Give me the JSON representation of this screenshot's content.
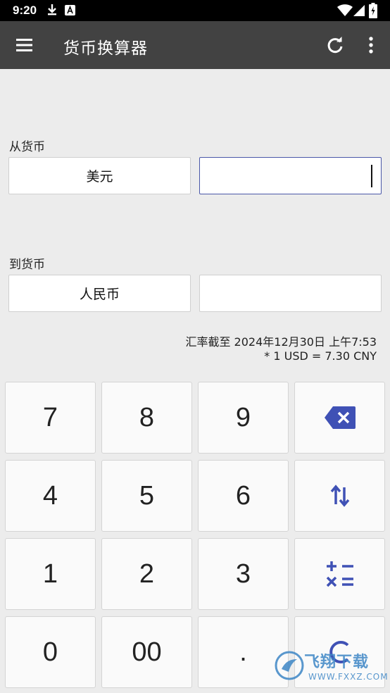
{
  "status_bar": {
    "time": "9:20"
  },
  "app_bar": {
    "title": "货币换算器"
  },
  "from": {
    "label": "从货币",
    "currency": "美元",
    "amount": ""
  },
  "to": {
    "label": "到货币",
    "currency": "人民币",
    "amount": ""
  },
  "rate": {
    "line1": "汇率截至 2024年12月30日 上午7:53",
    "line2": "* 1 USD = 7.30 CNY"
  },
  "keypad": {
    "k7": "7",
    "k8": "8",
    "k9": "9",
    "k4": "4",
    "k5": "5",
    "k6": "6",
    "k1": "1",
    "k2": "2",
    "k3": "3",
    "k0": "0",
    "k00": "00",
    "kdot": "."
  },
  "watermark": {
    "brand": "飞翔下载",
    "site": "WWW.FXXZ.COM"
  },
  "colors": {
    "accent": "#3f51b5",
    "appbar": "#424242",
    "background": "#ececec"
  },
  "icons": [
    "download-icon",
    "a-badge-icon",
    "wifi-icon",
    "signal-icon",
    "battery-icon",
    "menu-icon",
    "refresh-icon",
    "more-vert-icon",
    "backspace-icon",
    "swap-icon",
    "operators-icon",
    "clear-icon"
  ]
}
